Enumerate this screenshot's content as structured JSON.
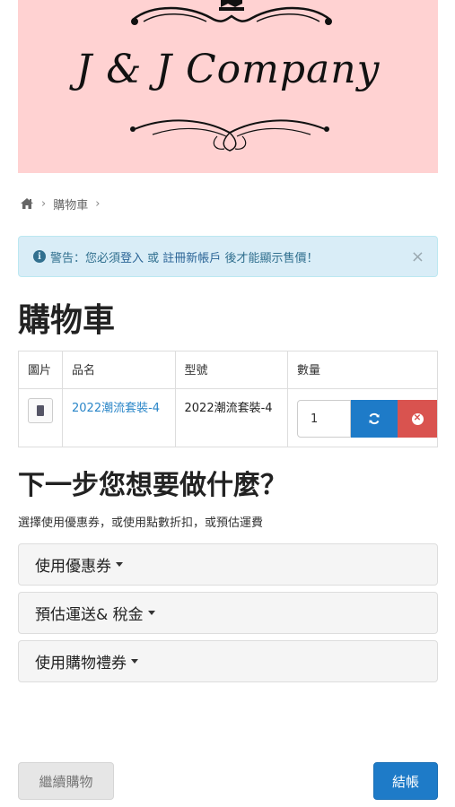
{
  "logo": {
    "text": "J & J Company"
  },
  "breadcrumb": {
    "items": [
      "購物車"
    ]
  },
  "alert": {
    "prefix": "警告：您必須",
    "login_link": "登入",
    "or": " 或 ",
    "register_link": "註冊新帳戶",
    "suffix": " 後才能顯示售價！",
    "close": "×"
  },
  "page": {
    "title": "購物車"
  },
  "cart": {
    "headers": {
      "image": "圖片",
      "name": "品名",
      "model": "型號",
      "quantity": "數量"
    },
    "rows": [
      {
        "name": "2022潮流套裝-4",
        "model": "2022潮流套裝-4",
        "quantity": "1"
      }
    ]
  },
  "next": {
    "title": "下一步您想要做什麼？",
    "description": "選擇使用優惠券，或使用點數折扣，或預估運費",
    "panels": [
      "使用優惠券",
      "預估運送& 稅金",
      "使用購物禮券"
    ]
  },
  "buttons": {
    "continue": "繼續購物",
    "checkout": "結帳"
  },
  "colors": {
    "banner_bg": "#ffd2d2",
    "primary": "#1e7bc8",
    "danger": "#d9534f",
    "alert_bg": "#d9edf7"
  },
  "icons": [
    "home-icon",
    "chevron-right-icon",
    "info-icon",
    "close-icon",
    "refresh-icon",
    "remove-icon",
    "caret-down-icon",
    "crown-icon"
  ]
}
